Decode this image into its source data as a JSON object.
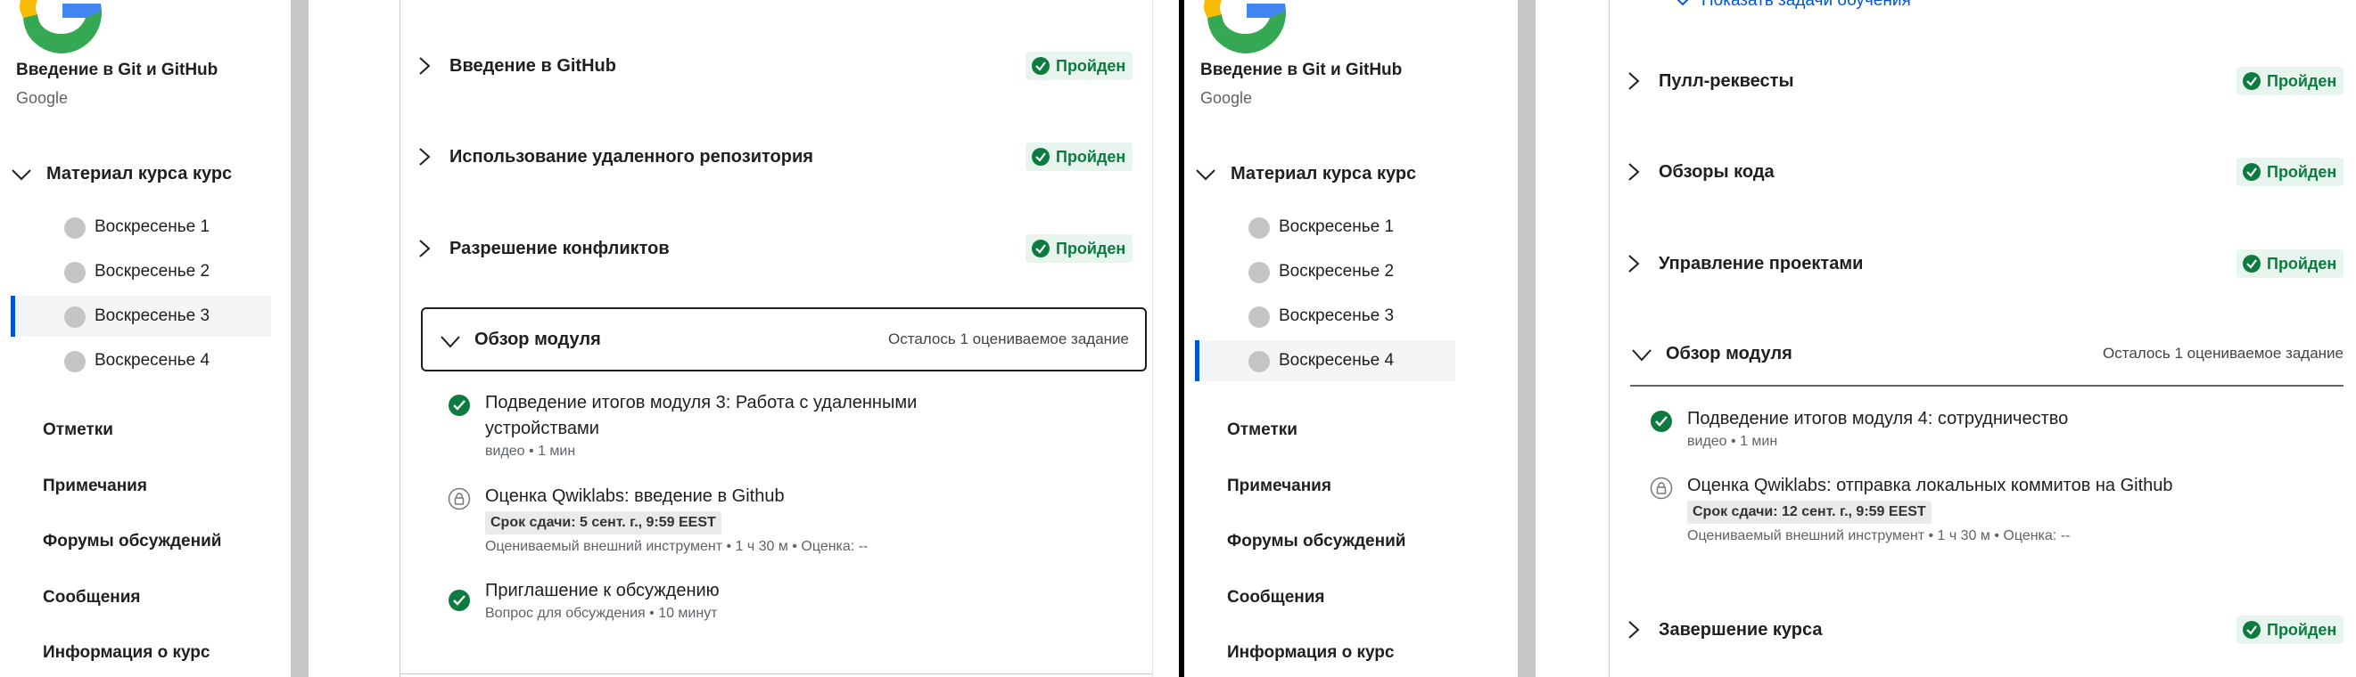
{
  "colors": {
    "accent": "#0056d2",
    "passed_green": "#0d7a3f",
    "passed_bg": "#e8f5ee"
  },
  "left": {
    "sidebar": {
      "course_title": "Введение в Git и GitHub",
      "org": "Google",
      "material_header": "Материал курса курс",
      "weeks": [
        {
          "label": "Воскресенье 1"
        },
        {
          "label": "Воскресенье 2"
        },
        {
          "label": "Воскресенье 3"
        },
        {
          "label": "Воскресенье 4"
        }
      ],
      "active_week": "Воскресенье 3",
      "links": [
        "Отметки",
        "Примечания",
        "Форумы обсуждений",
        "Сообщения",
        "Информация о курс"
      ]
    },
    "main": {
      "lessons": [
        {
          "title": "Введение в GitHub",
          "status": "Пройден"
        },
        {
          "title": "Использование удаленного репозитория",
          "status": "Пройден"
        },
        {
          "title": "Разрешение конфликтов",
          "status": "Пройден"
        }
      ],
      "module": {
        "title": "Обзор модуля",
        "remaining": "Осталось 1 оцениваемое задание"
      },
      "items": [
        {
          "title": "Подведение итогов модуля 3: Работа с удаленными устройствами",
          "meta": "видео • 1 мин",
          "icon": "check-circle-icon"
        },
        {
          "title": "Оценка Qwiklabs: введение в Github",
          "due": "Срок сдачи: 5 сент. г., 9:59 EEST",
          "meta": "Оцениваемый внешний инструмент • 1 ч 30 м •  Оценка: --",
          "icon": "lock-icon"
        },
        {
          "title": "Приглашение к обсуждению",
          "meta": "Вопрос для обсуждения • 10 минут",
          "icon": "check-circle-icon"
        }
      ]
    }
  },
  "right": {
    "sidebar": {
      "course_title": "Введение в Git и GitHub",
      "org": "Google",
      "material_header": "Материал курса курс",
      "weeks": [
        {
          "label": "Воскресенье 1"
        },
        {
          "label": "Воскресенье 2"
        },
        {
          "label": "Воскресенье 3"
        },
        {
          "label": "Воскресенье 4"
        }
      ],
      "active_week": "Воскресенье 4",
      "links": [
        "Отметки",
        "Примечания",
        "Форумы обсуждений",
        "Сообщения",
        "Информация о курс"
      ]
    },
    "main": {
      "show_tasks": "Показать задачи обучения",
      "lessons": [
        {
          "title": "Пулл-реквесты",
          "status": "Пройден"
        },
        {
          "title": "Обзоры кода",
          "status": "Пройден"
        },
        {
          "title": "Управление проектами",
          "status": "Пройден"
        }
      ],
      "module": {
        "title": "Обзор модуля",
        "remaining": "Осталось 1 оцениваемое задание"
      },
      "items": [
        {
          "title": "Подведение итогов модуля 4: сотрудничество",
          "meta": "видео • 1 мин",
          "icon": "check-circle-icon"
        },
        {
          "title": "Оценка Qwiklabs: отправка локальных коммитов на Github",
          "due": "Срок сдачи: 12 сент. г., 9:59 EEST",
          "meta": "Оцениваемый внешний инструмент • 1 ч 30 м •  Оценка: --",
          "icon": "lock-icon"
        }
      ],
      "final_lesson": {
        "title": "Завершение курса",
        "status": "Пройден"
      }
    }
  }
}
